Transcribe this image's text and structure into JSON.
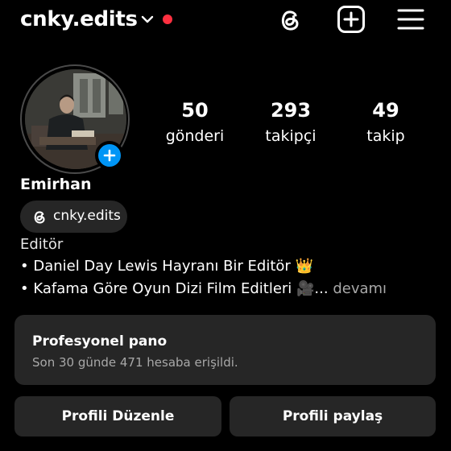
{
  "header": {
    "username": "cnky.edits"
  },
  "profile": {
    "stats": [
      {
        "value": "50",
        "label": "gönderi"
      },
      {
        "value": "293",
        "label": "takipçi"
      },
      {
        "value": "49",
        "label": "takip"
      }
    ],
    "name": "Emirhan",
    "threads_handle": "cnky.edits",
    "category": "Editör",
    "bio_line1": "• Daniel Day Lewis Hayranı Bir Editör 👑",
    "bio_line2": "• Kafama Göre Oyun Dizi Film Editleri 🎥...",
    "bio_more": " devamı"
  },
  "dashboard": {
    "title": "Profesyonel pano",
    "subtitle": "Son 30 günde 471 hesaba erişildi."
  },
  "actions": {
    "edit_label": "Profili Düzenle",
    "share_label": "Profili paylaş"
  },
  "colors": {
    "background": "#000000",
    "surface": "#262626",
    "accent": "#0095f6",
    "notification": "#ff3040"
  },
  "icons": [
    "chevron-down-icon",
    "threads-icon",
    "new-post-icon",
    "menu-icon",
    "add-story-icon"
  ]
}
